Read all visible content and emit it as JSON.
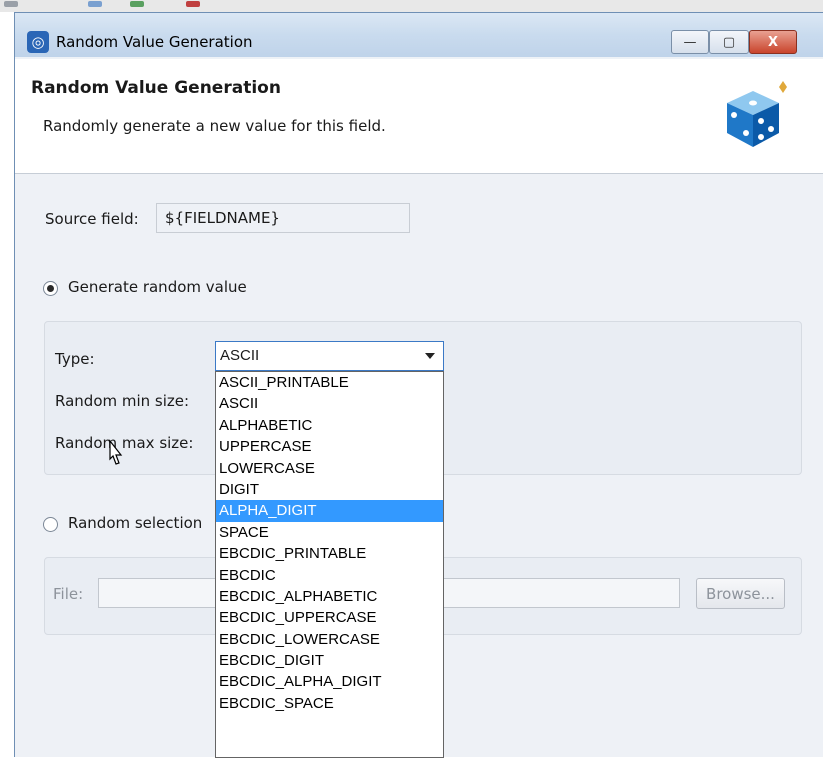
{
  "window": {
    "title": "Random Value Generation",
    "min_label": "—",
    "max_label": "▢",
    "close_label": "X"
  },
  "header": {
    "title": "Random Value Generation",
    "description": "Randomly generate a new value for this field."
  },
  "source": {
    "label": "Source field:",
    "value": "${FIELDNAME}"
  },
  "generate": {
    "radio_label": "Generate random value",
    "selected": true,
    "type_label": "Type:",
    "type_value": "ASCII",
    "min_label": "Random min size:",
    "max_label": "Random max size:"
  },
  "dropdown": {
    "options": [
      "ASCII_PRINTABLE",
      "ASCII",
      "ALPHABETIC",
      "UPPERCASE",
      "LOWERCASE",
      "DIGIT",
      "ALPHA_DIGIT",
      "SPACE",
      "EBCDIC_PRINTABLE",
      "EBCDIC",
      "EBCDIC_ALPHABETIC",
      "EBCDIC_UPPERCASE",
      "EBCDIC_LOWERCASE",
      "EBCDIC_DIGIT",
      "EBCDIC_ALPHA_DIGIT",
      "EBCDIC_SPACE"
    ],
    "highlighted": "ALPHA_DIGIT"
  },
  "selection": {
    "radio_label": "Random selection",
    "selected": false,
    "file_label": "File:",
    "file_value": "",
    "browse_label": "Browse..."
  }
}
